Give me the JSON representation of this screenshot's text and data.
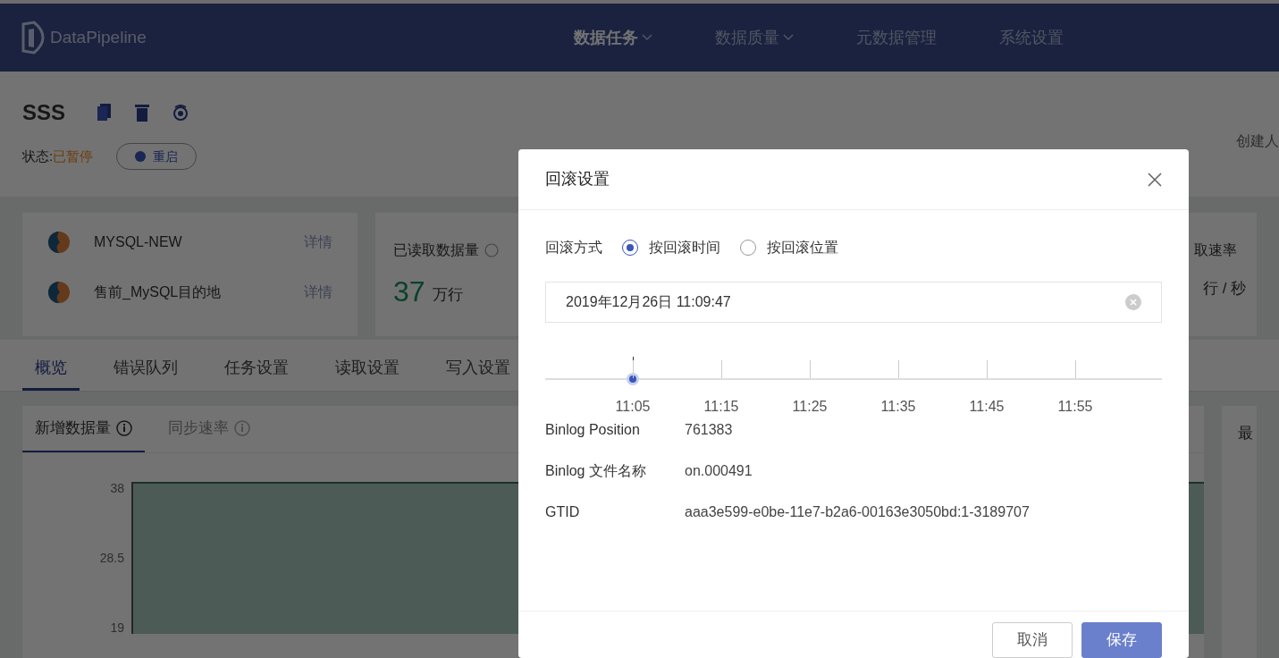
{
  "header": {
    "logo": "DataPipeline",
    "nav": [
      {
        "label": "数据任务",
        "dropdown": true,
        "selected": true
      },
      {
        "label": "数据质量",
        "dropdown": true,
        "selected": false
      },
      {
        "label": "元数据管理",
        "dropdown": false,
        "selected": false
      },
      {
        "label": "系统设置",
        "dropdown": false,
        "selected": false
      }
    ]
  },
  "task": {
    "name": "SSS",
    "status_label": "状态:",
    "status": "已暂停",
    "restart_button": "重启",
    "creator_label": "创建人"
  },
  "sources": [
    {
      "name": "MYSQL-NEW",
      "link": "详情"
    },
    {
      "name": "售前_MySQL目的地",
      "link": "详情"
    }
  ],
  "stats": [
    {
      "label": "已读取数据量",
      "value": "37",
      "unit": "万行"
    },
    {
      "label": "取速率",
      "unit": "行 / 秒"
    }
  ],
  "tabs": [
    {
      "label": "概览",
      "selected": true
    },
    {
      "label": "错误队列",
      "selected": false
    },
    {
      "label": "任务设置",
      "selected": false
    },
    {
      "label": "读取设置",
      "selected": false
    },
    {
      "label": "写入设置",
      "selected": false
    }
  ],
  "chart_tabs": [
    {
      "label": "新增数据量",
      "selected": true
    },
    {
      "label": "同步速率",
      "selected": false
    }
  ],
  "chart": {
    "y_ticks": [
      "38",
      "28.5",
      "19"
    ]
  },
  "side_panel": {
    "title": "最"
  },
  "dialog": {
    "title": "回滚设置",
    "mode_label": "回滚方式",
    "modes": [
      {
        "label": "按回滚时间",
        "selected": true
      },
      {
        "label": "按回滚位置",
        "selected": false
      }
    ],
    "datetime": "2019年12月26日 11:09:47",
    "timeline": {
      "level": 0.142,
      "ticks": [
        "11:05",
        "11:15",
        "11:25",
        "11:35",
        "11:45",
        "11:55"
      ]
    },
    "info": [
      {
        "label": "Binlog Position",
        "value": "761383"
      },
      {
        "label": "Binlog 文件名称",
        "value": "on.000491"
      },
      {
        "label": "GTID",
        "value": "aaa3e599-e0be-11e7-b2a6-00163e3050bd:1-3189707"
      }
    ],
    "buttons": [
      {
        "label": "取消",
        "kind": "secondary"
      },
      {
        "label": "保存",
        "kind": "primary"
      }
    ]
  }
}
